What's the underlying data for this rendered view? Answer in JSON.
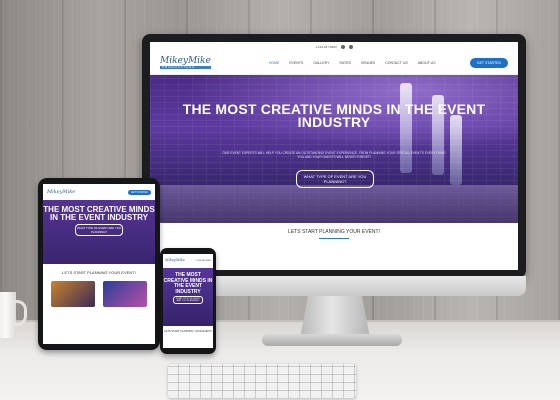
{
  "site": {
    "logo_name": "MikeyMike",
    "logo_tag": "PRODUCTIONS",
    "topbar_phone": "1-234-567-8900",
    "nav_items": [
      "HOME",
      "EVENTS",
      "GALLERY",
      "RATES",
      "VENUES",
      "CONTACT US",
      "ABOUT US"
    ],
    "cta_label": "GET STARTED",
    "hero_title": "THE MOST CREATIVE MINDS IN THE EVENT INDUSTRY",
    "hero_subtitle": "OUR EVENT EXPERTS WILL HELP YOU CREATE AN OUTSTANDING EVENT EXPERIENCE. FROM PLANNING YOUR SPECIAL EVENT'S EVERYTHING YOU AND YOUR GUESTS WILL NEVER FORGET!",
    "hero_button": "WHAT TYPE OF EVENT ARE YOU PLANNING?",
    "section_heading": "LETS START PLANNING YOUR EVENT!"
  },
  "tablet": {
    "hero_title": "THE MOST CREATIVE MINDS IN THE EVENT INDUSTRY",
    "hero_button": "WHAT TYPE OF EVENT ARE YOU PLANNING?",
    "section_heading": "LETS START PLANNING YOUR EVENT!"
  },
  "phone": {
    "hero_title": "THE MOST CREATIVE MINDS IN THE EVENT INDUSTRY",
    "hero_button": "WHAT TYPE OF EVENT ARE YOU PLANNING?",
    "section_heading": "LETS START PLANNING YOUR EVENT!"
  },
  "colors": {
    "brand_blue": "#1f6fc4",
    "hero_purple": "#4b2a86"
  }
}
